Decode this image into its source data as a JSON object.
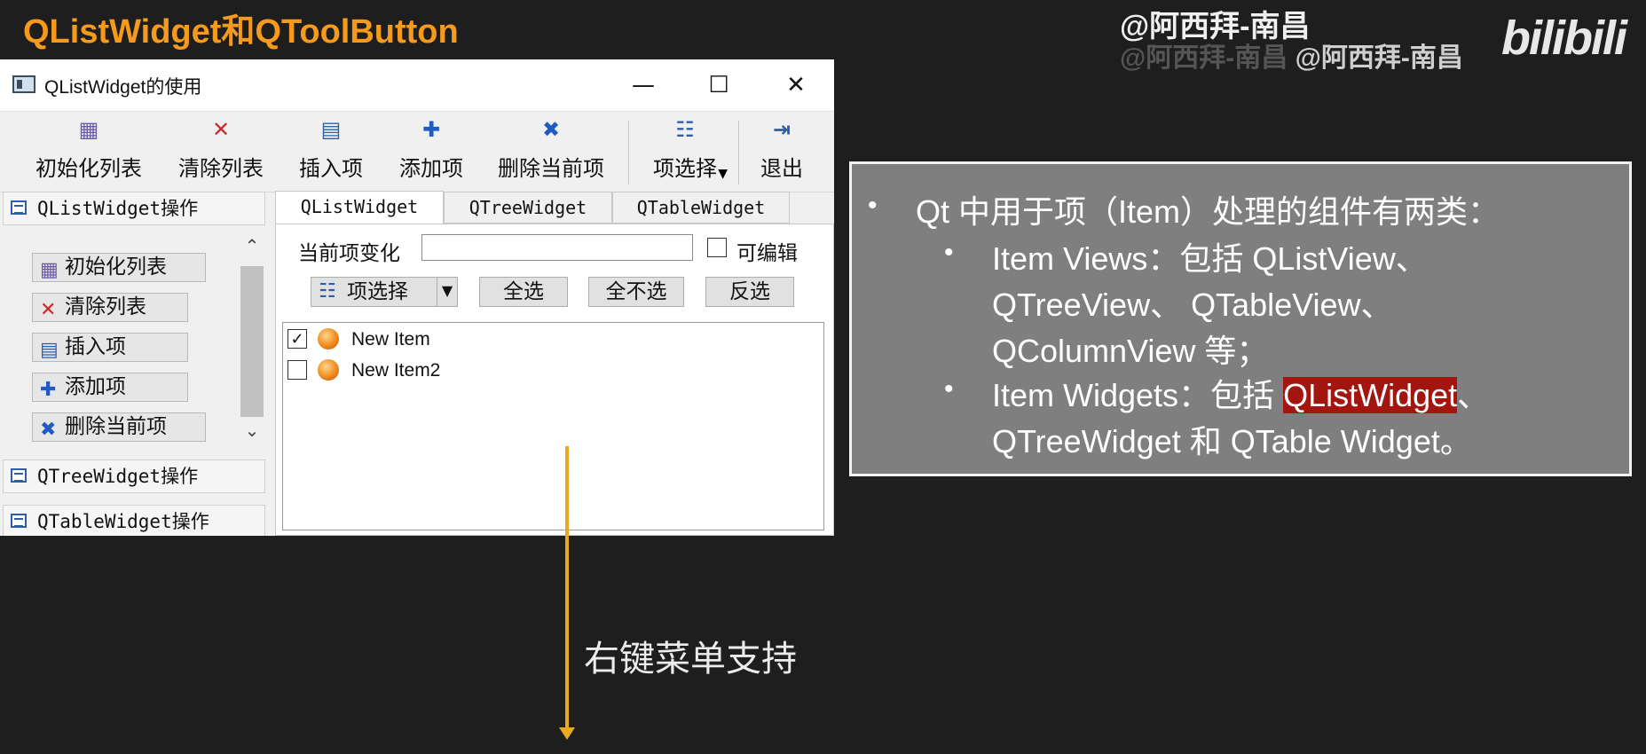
{
  "slide": {
    "title": "QListWidget和QToolButton"
  },
  "watermark": {
    "line1": "@阿西拜-南昌",
    "line2": "@阿西拜-南昌",
    "logo": "bilibili"
  },
  "window": {
    "title": "QListWidget的使用",
    "controls": {
      "minimize": "—",
      "maximize": "☐",
      "close": "✕"
    },
    "toolbar": [
      {
        "label": "初始化列表",
        "icon": "list-init-icon",
        "glyph": "▦",
        "color": "#6a5aa8"
      },
      {
        "label": "清除列表",
        "icon": "clear-icon",
        "glyph": "✕",
        "color": "#d02828"
      },
      {
        "label": "插入项",
        "icon": "insert-icon",
        "glyph": "▤",
        "color": "#2d5ea8"
      },
      {
        "label": "添加项",
        "icon": "add-icon",
        "glyph": "✚",
        "color": "#1f5bc4"
      },
      {
        "label": "删除当前项",
        "icon": "delete-icon",
        "glyph": "✖",
        "color": "#1f5bc4"
      },
      {
        "label": "项选择",
        "icon": "select-icon",
        "glyph": "☷",
        "color": "#2d5ea8"
      },
      {
        "label": "退出",
        "icon": "exit-icon",
        "glyph": "⇥",
        "color": "#2d5ea8"
      }
    ],
    "toolbox": {
      "sections": [
        "QListWidget操作",
        "QTreeWidget操作",
        "QTableWidget操作"
      ],
      "buttons": [
        {
          "label": "初始化列表",
          "glyph": "▦",
          "color": "#6a5aa8"
        },
        {
          "label": "清除列表",
          "glyph": "✕",
          "color": "#d02828"
        },
        {
          "label": "插入项",
          "glyph": "▤",
          "color": "#2d5ea8"
        },
        {
          "label": "添加项",
          "glyph": "✚",
          "color": "#1f5bc4"
        },
        {
          "label": "删除当前项",
          "glyph": "✖",
          "color": "#1f5bc4"
        }
      ]
    },
    "tabs": [
      "QListWidget",
      "QTreeWidget",
      "QTableWidget"
    ],
    "current_item_label": "当前项变化",
    "current_item_value": "",
    "editable_label": "可编辑",
    "editable_checked": false,
    "select_tool": {
      "label": "项选择",
      "arrow": "▾"
    },
    "buttons": {
      "select_all": "全选",
      "select_none": "全不选",
      "invert": "反选"
    },
    "list_items": [
      {
        "text": "New Item",
        "checked": true
      },
      {
        "text": "New Item2",
        "checked": false
      }
    ]
  },
  "annotation": "右键菜单支持",
  "info": {
    "line1": "Qt 中用于项（Item）处理的组件有两类：",
    "line2": "Item Views：包括 QListView、",
    "line3": "QTreeView、 QTableView、",
    "line4": "QColumnView 等；",
    "line5_pre": "Item Widgets：包括 ",
    "line5_hl": "QListWidget",
    "line5_post": "、",
    "line6": "QTreeWidget 和 QTable Widget。"
  }
}
